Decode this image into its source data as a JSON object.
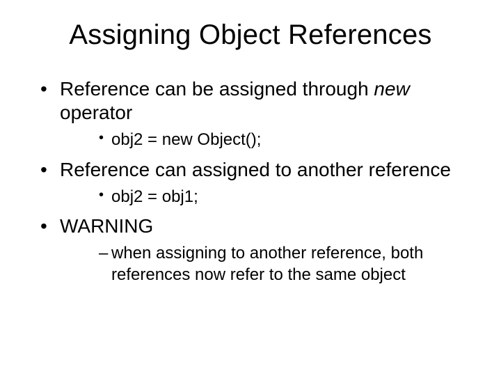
{
  "title": "Assigning Object References",
  "bullets": {
    "b1": {
      "text_a": "Reference can be assigned through ",
      "text_b": "new",
      "text_c": " operator",
      "sub": "obj2 = new Object();"
    },
    "b2": {
      "text": "Reference can assigned to another reference",
      "sub": "obj2 = obj1;"
    },
    "b3": {
      "text": "WARNING",
      "sub": "when assigning to another reference, both references now refer to the same object"
    }
  }
}
